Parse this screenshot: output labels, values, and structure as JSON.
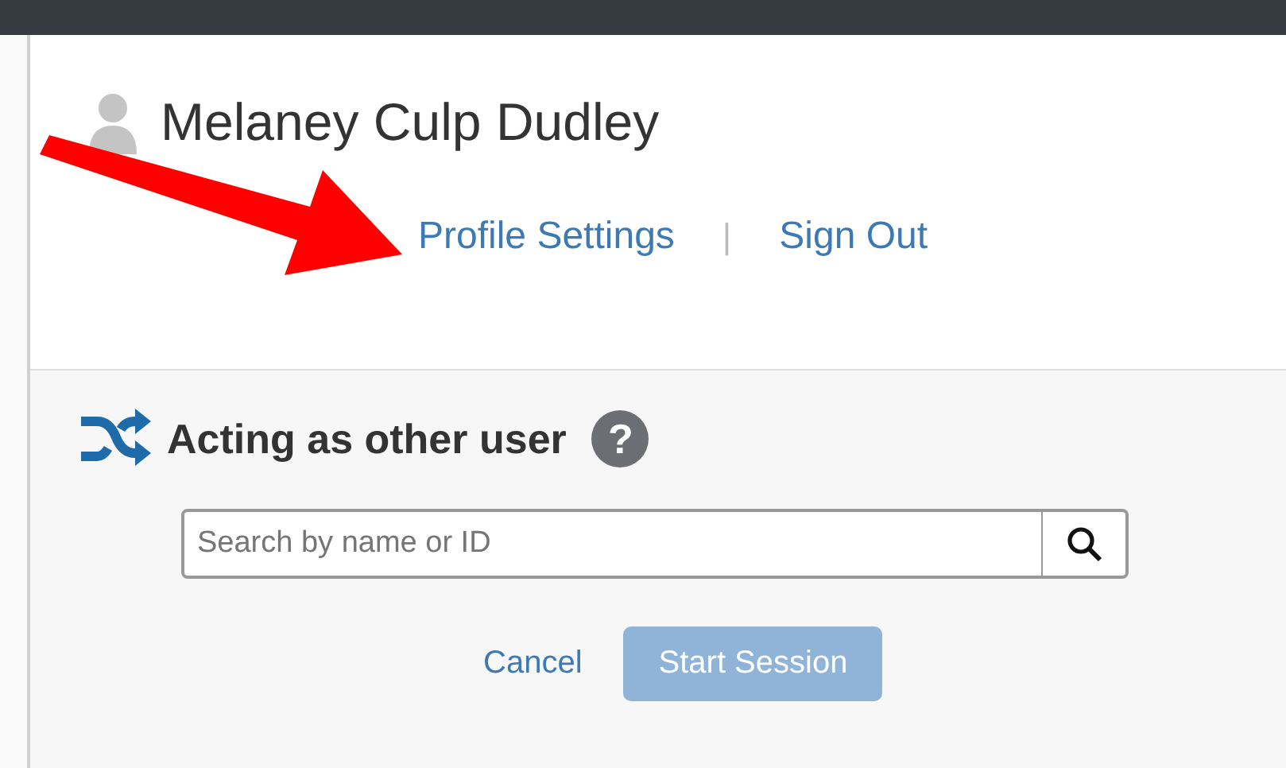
{
  "user": {
    "name": "Melaney Culp Dudley"
  },
  "links": [
    {
      "label": "Profile Settings"
    },
    {
      "label": "Sign Out"
    }
  ],
  "link_separator": "|",
  "acting": {
    "title": "Acting as other user",
    "help": "?"
  },
  "search": {
    "placeholder": "Search by name or ID"
  },
  "buttons": [
    {
      "label": "Cancel",
      "kind": "link",
      "disabled": false
    },
    {
      "label": "Start Session",
      "kind": "primary",
      "disabled": true
    }
  ]
}
